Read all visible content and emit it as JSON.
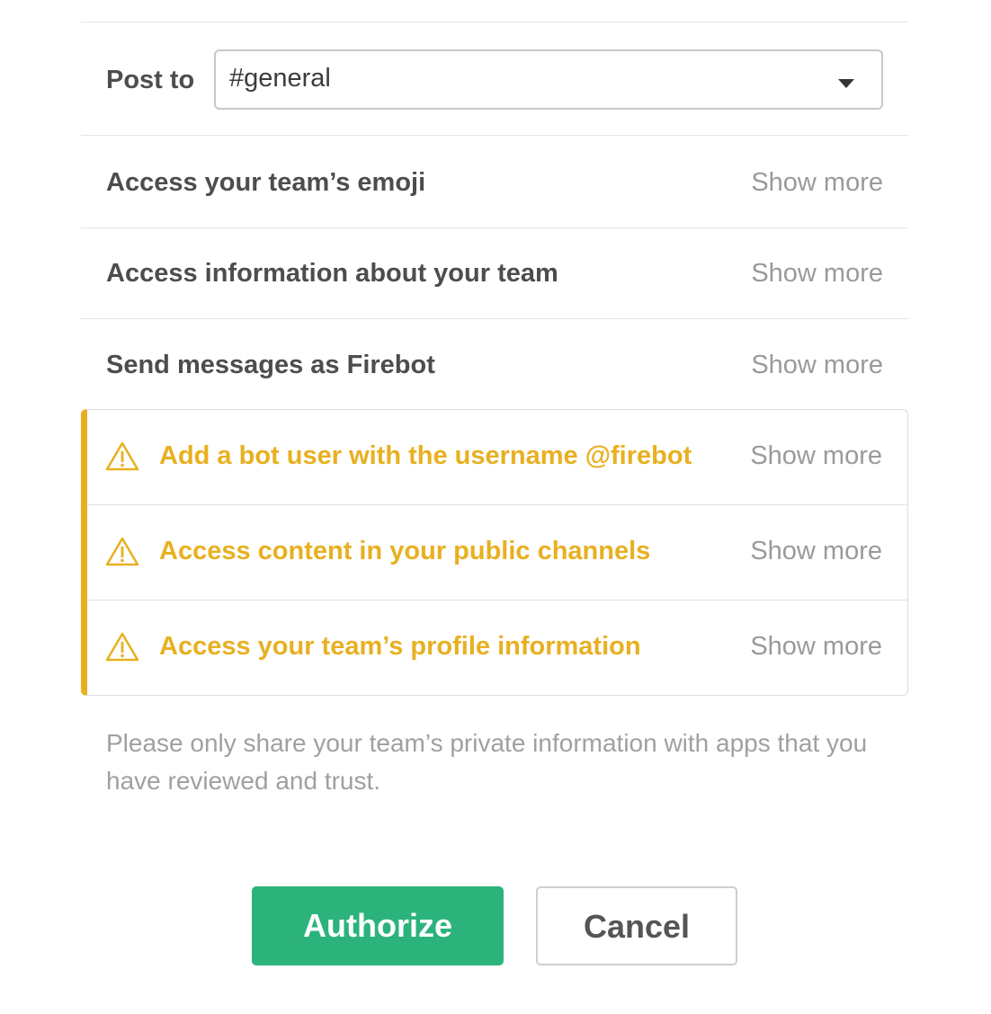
{
  "post_to": {
    "label": "Post to",
    "selected_channel": "#general",
    "dropdown_icon": "caret-down-icon"
  },
  "permissions": [
    {
      "label": "Access your team’s emoji",
      "action": "Show more"
    },
    {
      "label": "Access information about your team",
      "action": "Show more"
    },
    {
      "label": "Send messages as Firebot",
      "action": "Show more"
    }
  ],
  "warnings": [
    {
      "label": "Add a bot user with the username @firebot",
      "action": "Show more",
      "icon": "warning-icon"
    },
    {
      "label": "Access content in your public channels",
      "action": "Show more",
      "icon": "warning-icon"
    },
    {
      "label": "Access your team’s profile information",
      "action": "Show more",
      "icon": "warning-icon"
    }
  ],
  "disclaimer": "Please only share your team’s private information with apps that you have reviewed and trust.",
  "buttons": {
    "authorize": "Authorize",
    "cancel": "Cancel"
  },
  "colors": {
    "warning": "#e8b021",
    "primary": "#2bb37b",
    "muted_text": "#9a9a9a",
    "body_text": "#4d4d4d"
  }
}
